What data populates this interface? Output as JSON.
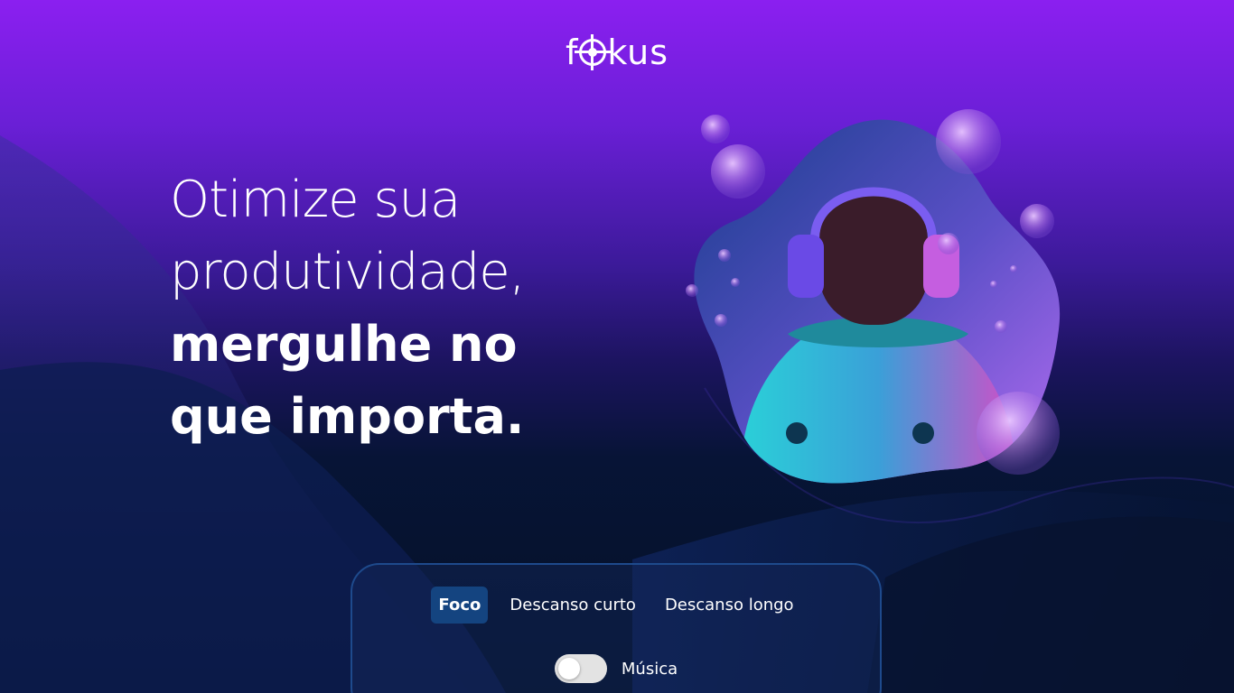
{
  "brand": {
    "logo_prefix": "f",
    "logo_suffix": "kus"
  },
  "hero": {
    "line1": "Otimize sua",
    "line2": "produtividade,",
    "line3": "mergulhe no",
    "line4": "que importa."
  },
  "timer": {
    "tabs": [
      {
        "label": "Foco",
        "active": true
      },
      {
        "label": "Descanso curto",
        "active": false
      },
      {
        "label": "Descanso longo",
        "active": false
      }
    ],
    "music_label": "Música",
    "music_enabled": false
  },
  "colors": {
    "bg_top": "#8b1ff0",
    "bg_bottom": "#041126",
    "card_border": "#1e4a8c",
    "active_tab": "#144480"
  }
}
